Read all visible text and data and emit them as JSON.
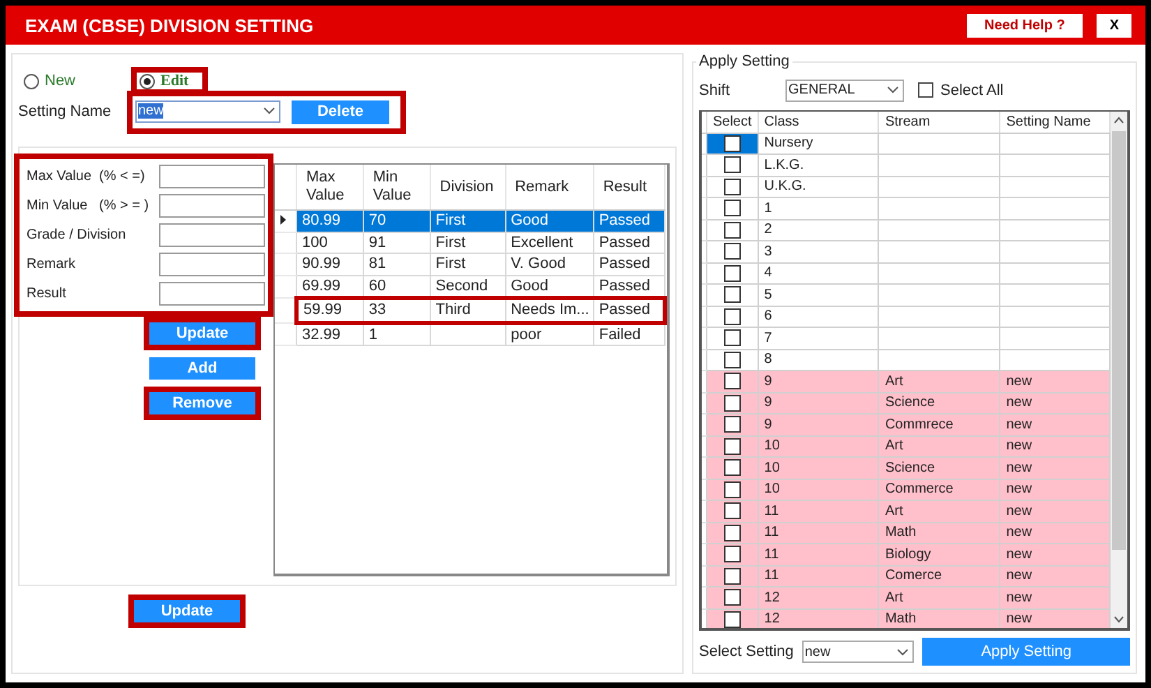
{
  "window": {
    "title": "EXAM (CBSE) DIVISION SETTING",
    "help_button": "Need Help ?",
    "close_button": "X"
  },
  "mode": [
    {
      "label": "New",
      "selected": false,
      "highlighted": false
    },
    {
      "label": "Edit",
      "selected": true,
      "highlighted": true
    }
  ],
  "setting_name": {
    "label": "Setting Name",
    "value": "new",
    "delete_button": "Delete",
    "highlighted": true
  },
  "form": {
    "highlighted": true,
    "fields": [
      {
        "label": "Max Value  (% < =)"
      },
      {
        "label": "Min Value   (% > = )"
      },
      {
        "label": "Grade / Division"
      },
      {
        "label": "Remark"
      },
      {
        "label": "Result"
      }
    ],
    "buttons": [
      {
        "label": "Update",
        "highlighted": true
      },
      {
        "label": "Add",
        "highlighted": false
      },
      {
        "label": "Remove",
        "highlighted": true
      }
    ]
  },
  "division_table": {
    "columns": [
      "Max Value",
      "Min Value",
      "Division",
      "Remark",
      "Result"
    ],
    "rows": [
      {
        "cells": [
          "80.99",
          "70",
          "First",
          "Good",
          "Passed"
        ],
        "selected": true,
        "highlighted": false
      },
      {
        "cells": [
          "100",
          "91",
          "First",
          "Excellent",
          "Passed"
        ],
        "selected": false,
        "highlighted": false
      },
      {
        "cells": [
          "90.99",
          "81",
          "First",
          "V. Good",
          "Passed"
        ],
        "selected": false,
        "highlighted": false
      },
      {
        "cells": [
          "69.99",
          "60",
          "Second",
          "Good",
          "Passed"
        ],
        "selected": false,
        "highlighted": false
      },
      {
        "cells": [
          "59.99",
          "33",
          "Third",
          "Needs Im...",
          "Passed"
        ],
        "selected": false,
        "highlighted": true
      },
      {
        "cells": [
          "32.99",
          "1",
          "",
          "poor",
          "Failed"
        ],
        "selected": false,
        "highlighted": false
      }
    ]
  },
  "bottom_button": {
    "label": "Update",
    "highlighted": true
  },
  "apply": {
    "title": "Apply Setting",
    "shift_label": "Shift",
    "shift_value": "GENERAL",
    "select_all": {
      "label": "Select All",
      "checked": false
    },
    "columns": [
      "Select",
      "Class",
      "Stream",
      "Setting Name"
    ],
    "rows": [
      {
        "checked": false,
        "selected": true,
        "color": "#ffffff",
        "class": "Nursery"
      },
      {
        "checked": false,
        "selected": false,
        "color": "#ffffff",
        "class": "L.K.G."
      },
      {
        "checked": false,
        "selected": false,
        "color": "#ffffff",
        "class": "U.K.G."
      },
      {
        "checked": false,
        "selected": false,
        "color": "#ffffff",
        "class": "1"
      },
      {
        "checked": false,
        "selected": false,
        "color": "#ffffff",
        "class": "2"
      },
      {
        "checked": false,
        "selected": false,
        "color": "#ffffff",
        "class": "3"
      },
      {
        "checked": false,
        "selected": false,
        "color": "#ffffff",
        "class": "4"
      },
      {
        "checked": false,
        "selected": false,
        "color": "#ffffff",
        "class": "5"
      },
      {
        "checked": false,
        "selected": false,
        "color": "#ffffff",
        "class": "6"
      },
      {
        "checked": false,
        "selected": false,
        "color": "#ffffff",
        "class": "7"
      },
      {
        "checked": false,
        "selected": false,
        "color": "#ffffff",
        "class": "8"
      },
      {
        "checked": false,
        "selected": false,
        "color": "#ffc0cb",
        "class": "9",
        "stream": "Art",
        "setting": "new"
      },
      {
        "checked": false,
        "selected": false,
        "color": "#ffc0cb",
        "class": "9",
        "stream": "Science",
        "setting": "new"
      },
      {
        "checked": false,
        "selected": false,
        "color": "#ffc0cb",
        "class": "9",
        "stream": "Commrece",
        "setting": "new"
      },
      {
        "checked": false,
        "selected": false,
        "color": "#ffc0cb",
        "class": "10",
        "stream": "Art",
        "setting": "new"
      },
      {
        "checked": false,
        "selected": false,
        "color": "#ffc0cb",
        "class": "10",
        "stream": "Science",
        "setting": "new"
      },
      {
        "checked": false,
        "selected": false,
        "color": "#ffc0cb",
        "class": "10",
        "stream": "Commerce",
        "setting": "new"
      },
      {
        "checked": false,
        "selected": false,
        "color": "#ffc0cb",
        "class": "11",
        "stream": "Art",
        "setting": "new"
      },
      {
        "checked": false,
        "selected": false,
        "color": "#ffc0cb",
        "class": "11",
        "stream": "Math",
        "setting": "new"
      },
      {
        "checked": false,
        "selected": false,
        "color": "#ffc0cb",
        "class": "11",
        "stream": "Biology",
        "setting": "new"
      },
      {
        "checked": false,
        "selected": false,
        "color": "#ffc0cb",
        "class": "11",
        "stream": "Comerce",
        "setting": "new"
      },
      {
        "checked": false,
        "selected": false,
        "color": "#ffc0cb",
        "class": "12",
        "stream": "Art",
        "setting": "new"
      },
      {
        "checked": false,
        "selected": false,
        "color": "#ffc0cb",
        "class": "12",
        "stream": "Math",
        "setting": "new"
      }
    ],
    "select_setting_label": "Select Setting",
    "select_setting_value": "new",
    "apply_button": "Apply Setting"
  }
}
